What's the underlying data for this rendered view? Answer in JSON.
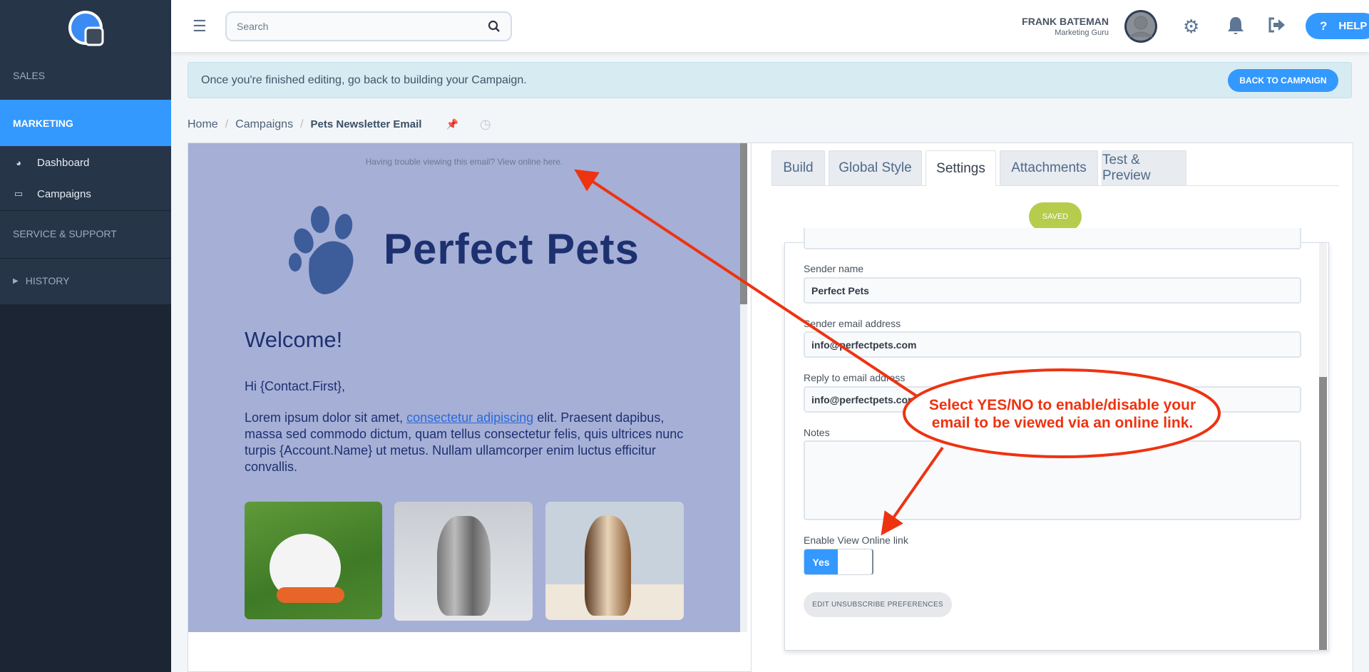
{
  "sidebar": {
    "logo": "logo",
    "sales": "SALES",
    "marketing": "MARKETING",
    "dashboard": "Dashboard",
    "campaigns": "Campaigns",
    "service": "SERVICE & SUPPORT",
    "history": "HISTORY"
  },
  "header": {
    "search_placeholder": "Search",
    "user_name": "FRANK BATEMAN",
    "user_role": "Marketing Guru",
    "help": "HELP"
  },
  "banner": {
    "text": "Once you're finished editing, go back to building your Campaign.",
    "button": "BACK TO CAMPAIGN"
  },
  "breadcrumb": {
    "home": "Home",
    "campaigns": "Campaigns",
    "current": "Pets Newsletter Email"
  },
  "email": {
    "view_online": "Having trouble viewing this email? View online here.",
    "brand": "Perfect Pets",
    "heading": "Welcome!",
    "greeting": "Hi {Contact.First},",
    "body_before": "Lorem ipsum dolor sit amet, ",
    "body_link": "consectetur adipiscing",
    "body_after": " elit. Praesent dapibus, massa sed commodo dictum, quam tellus consectetur felis, quis ultrices nunc turpis {Account.Name} ut metus. Nullam ullamcorper enim luctus efficitur convallis.",
    "images": [
      "rabbit",
      "kitten",
      "puppy"
    ]
  },
  "tabs": [
    {
      "label": "Build"
    },
    {
      "label": "Global Style"
    },
    {
      "label": "Settings",
      "active": true
    },
    {
      "label": "Attachments"
    },
    {
      "label": "Test & Preview"
    }
  ],
  "status": "SAVED",
  "form": {
    "sender_name_label": "Sender name",
    "sender_name": "Perfect Pets",
    "sender_email_label": "Sender email address",
    "sender_email": "info@perfectpets.com",
    "reply_label": "Reply to email address",
    "reply_email": "info@perfectpets.com",
    "notes_label": "Notes",
    "notes": "",
    "view_online_label": "Enable View Online link",
    "toggle": "Yes",
    "unsubscribe_button": "EDIT UNSUBSCRIBE PREFERENCES"
  },
  "annotation": {
    "line1": "Select YES/NO to enable/disable your",
    "line2": "email to be viewed via an online link."
  },
  "colors": {
    "accent": "#3399ff",
    "saved": "#b5cc4d",
    "annotation": "#ee3311",
    "email_bg": "#a6afd6",
    "brand": "#1d3170"
  }
}
